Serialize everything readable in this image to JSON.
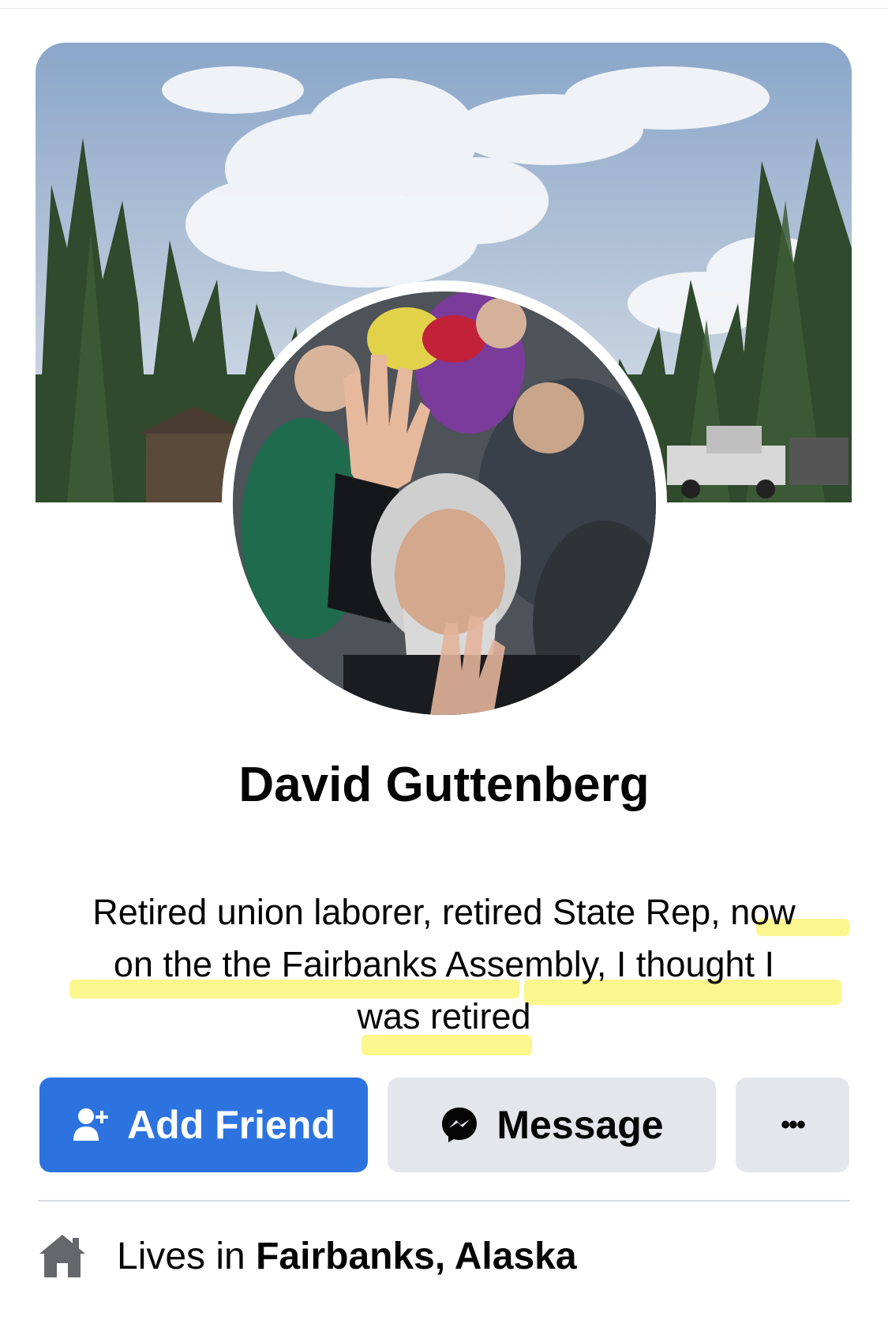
{
  "profile": {
    "name": "David Guttenberg",
    "bio_lines": [
      "Retired union laborer, retired State Rep, now",
      "on the the Fairbanks Assembly, I thought I",
      "was retired"
    ]
  },
  "actions": {
    "add_friend_label": "Add Friend",
    "message_label": "Message",
    "more_label": "•••"
  },
  "intro": {
    "lives_prefix": "Lives in ",
    "lives_city": "Fairbanks, Alaska"
  },
  "icons": {
    "add_friend": "person-add-icon",
    "message": "messenger-icon",
    "lives": "home-icon"
  },
  "colors": {
    "primary": "#2d73e0",
    "secondary_button": "#e4e6eb",
    "highlight": "#fbf57a"
  }
}
